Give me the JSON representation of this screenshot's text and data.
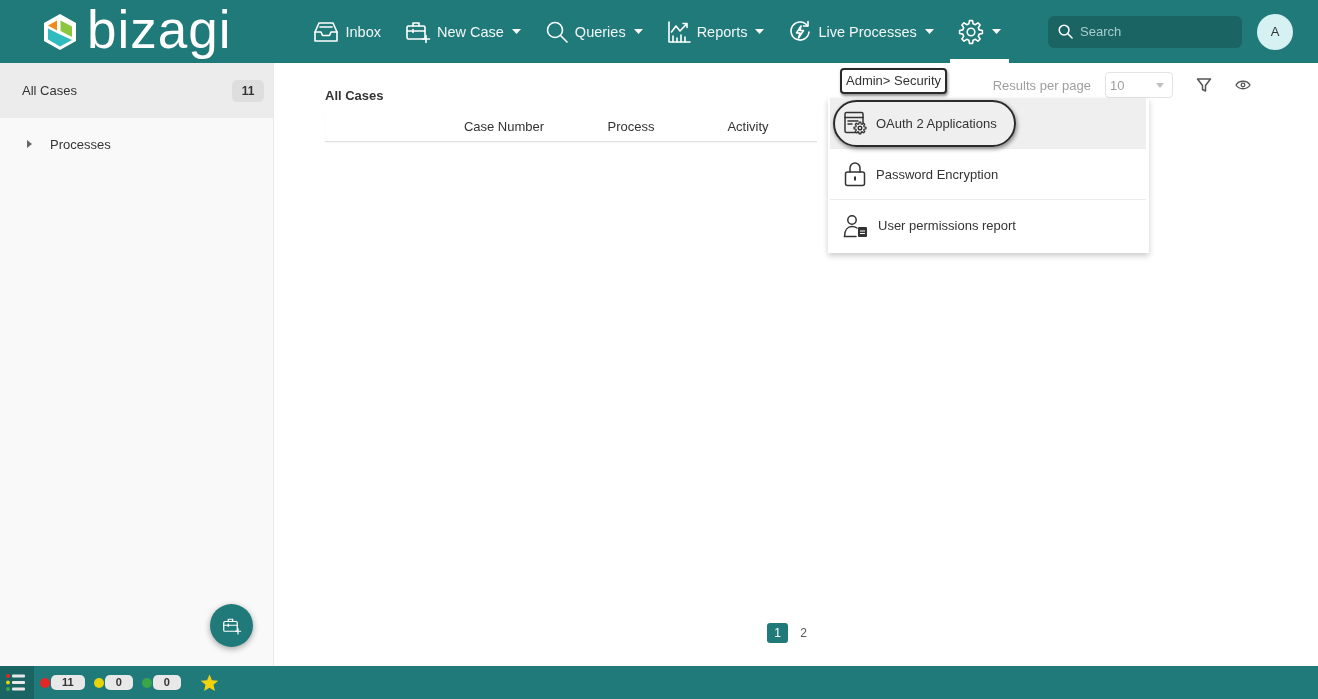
{
  "header": {
    "logo": "bizagi",
    "nav": [
      {
        "kind": "inbox",
        "label": "Inbox",
        "menu": false,
        "selected": false
      },
      {
        "kind": "new-case",
        "label": "New Case",
        "menu": true,
        "selected": false
      },
      {
        "kind": "queries",
        "label": "Queries",
        "menu": true,
        "selected": false
      },
      {
        "kind": "reports",
        "label": "Reports",
        "menu": true,
        "selected": false
      },
      {
        "kind": "live-processes",
        "label": "Live Processes",
        "menu": true,
        "selected": false
      },
      {
        "kind": "settings",
        "menu": true,
        "selected": true
      }
    ],
    "search": {
      "placeholder": "Search"
    },
    "avatar": "A"
  },
  "sidebar": {
    "items": [
      {
        "label": "All Cases",
        "count": "11",
        "selected": true
      },
      {
        "label": "Processes",
        "expanded": false,
        "selected": false
      }
    ]
  },
  "main": {
    "title": "All Cases",
    "results_per_page": {
      "label": "Results per page",
      "value": "10"
    },
    "table": {
      "columns": [
        "Case Number",
        "Process",
        "Activity"
      ]
    },
    "pagination": [
      {
        "label": "1",
        "selected": true
      },
      {
        "label": "2",
        "selected": false
      }
    ]
  },
  "settings_menu": {
    "header": {
      "label": "Admin> Security",
      "outlined": true
    },
    "items": [
      {
        "kind": "oauth",
        "label": "OAuth 2 Applications",
        "selected": true,
        "outlined": true
      },
      {
        "kind": "password",
        "label": "Password Encryption",
        "selected": false,
        "outlined": false
      },
      {
        "kind": "user-permissions",
        "label": "User permissions report",
        "selected": false,
        "outlined": false
      }
    ]
  },
  "status_bar": {
    "counters": [
      {
        "color": "#e32626",
        "count": "11"
      },
      {
        "color": "#e6d40a",
        "count": "0"
      },
      {
        "color": "#3aa64a",
        "count": "0"
      }
    ]
  }
}
